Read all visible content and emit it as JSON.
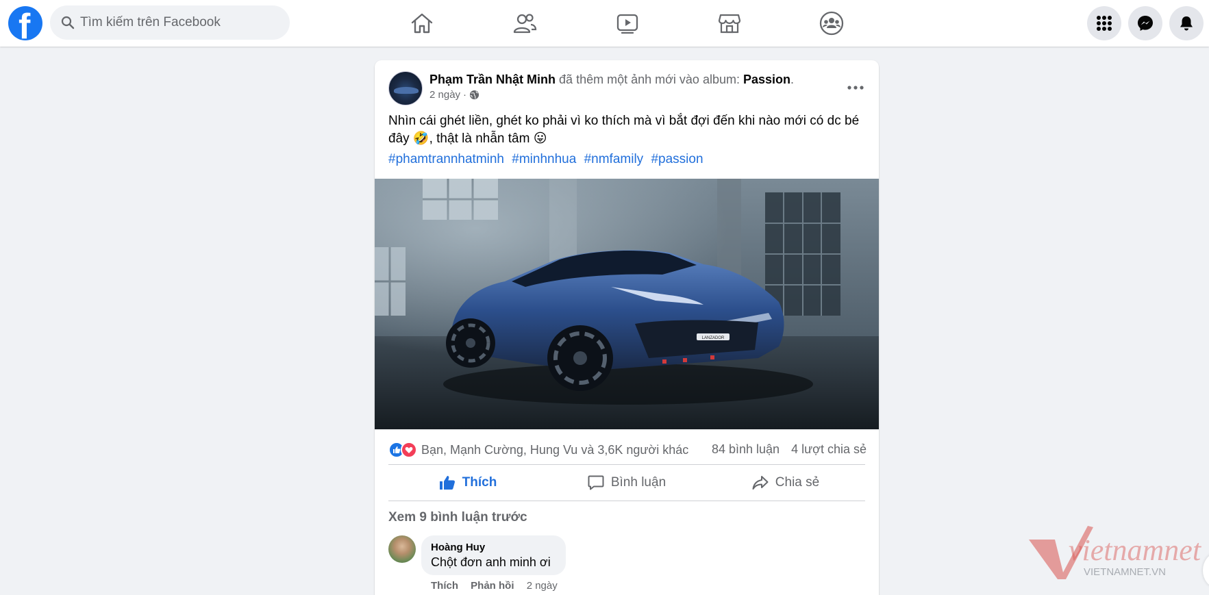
{
  "topbar": {
    "search_placeholder": "Tìm kiếm trên Facebook",
    "logo_letter": "f",
    "nav_icons": [
      "home-icon",
      "friends-icon",
      "watch-icon",
      "marketplace-icon",
      "groups-icon"
    ],
    "right_icons": [
      "menu-grid-icon",
      "messenger-icon",
      "notifications-bell-icon"
    ],
    "brand_color": "#1877f2"
  },
  "post": {
    "author": "Phạm Trần Nhật Minh",
    "action_text": "đã thêm một ảnh mới vào album:",
    "album": "Passion",
    "album_suffix": ".",
    "time": "2 ngày",
    "separator": "·",
    "privacy_icon": "globe-icon",
    "text_line1": "Nhìn cái ghét liền, ghét ko phải vì ko thích mà vì bắt đợi đến khi nào mới có dc bé",
    "text_line2_a": "đây",
    "emoji1": "🤣",
    "text_line2_b": ", thật là nhẫn tâm",
    "emoji2": "😛",
    "hashtags": [
      "#phamtrannhatminh",
      "#minhnhua",
      "#nmfamily",
      "#passion"
    ],
    "photo_plate": "LANZADOR",
    "reactions_text": "Bạn, Mạnh Cường, Hung Vu và 3,6K người khác",
    "comments_count": "84 bình luận",
    "shares_count": "4 lượt chia sẻ",
    "actions": {
      "like": "Thích",
      "comment": "Bình luận",
      "share": "Chia sẻ"
    },
    "link_color": "#216fdb"
  },
  "comments": {
    "view_previous": "Xem 9 bình luận trước",
    "items": [
      {
        "name": "Hoàng Huy",
        "text": "Chột đơn anh minh ơi",
        "like": "Thích",
        "reply": "Phản hồi",
        "time": "2 ngày"
      }
    ]
  },
  "watermark": {
    "brand": "vietnamnet",
    "domain": "VIETNAMNET.VN"
  }
}
